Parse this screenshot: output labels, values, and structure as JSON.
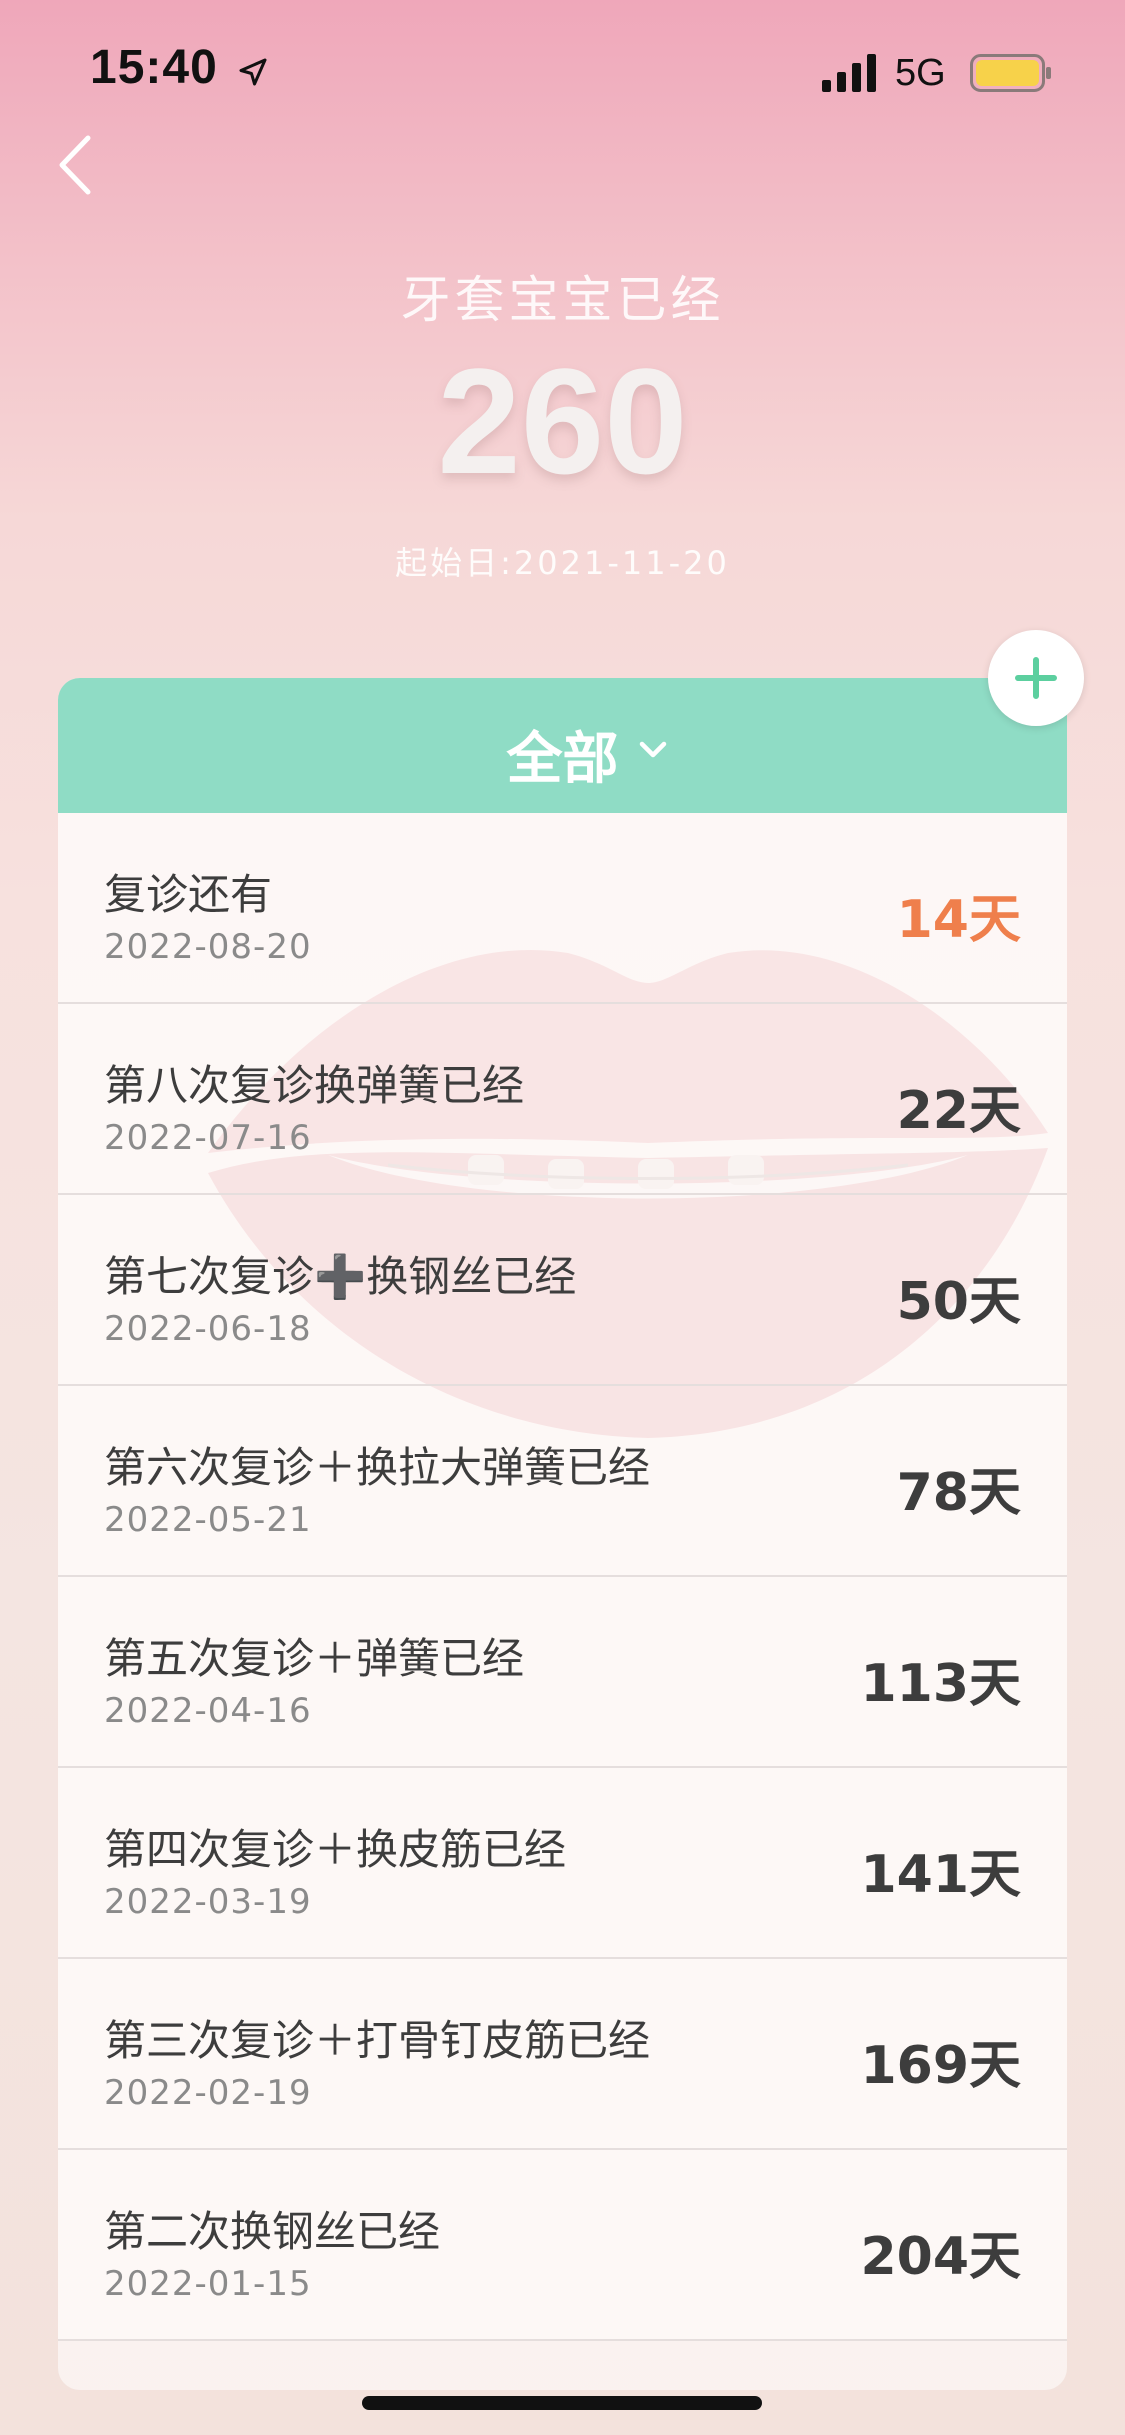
{
  "status_bar": {
    "time": "15:40",
    "network": "5G",
    "icons": [
      "location-arrow-icon",
      "signal-bars-icon",
      "battery-icon"
    ],
    "battery_color": "#f7d24a"
  },
  "nav": {
    "back_icon": "chevron-left-icon"
  },
  "header": {
    "subtitle": "牙套宝宝已经",
    "count": "260",
    "start_date": "起始日:2021-11-20"
  },
  "filter": {
    "label": "全部",
    "icon": "chevron-down-icon",
    "color": "#8fdcc5"
  },
  "add_button": {
    "icon": "plus-icon",
    "color": "#5ccf9f"
  },
  "accent_color": "#ef7f4c",
  "items": [
    {
      "title": "复诊还有",
      "date": "2022-08-20",
      "days": "14天"
    },
    {
      "title": "第八次复诊换弹簧已经",
      "date": "2022-07-16",
      "days": "22天"
    },
    {
      "title": "第七次复诊➕换钢丝已经",
      "date": "2022-06-18",
      "days": "50天"
    },
    {
      "title": "第六次复诊＋换拉大弹簧已经",
      "date": "2022-05-21",
      "days": "78天"
    },
    {
      "title": "第五次复诊＋弹簧已经",
      "date": "2022-04-16",
      "days": "113天"
    },
    {
      "title": "第四次复诊＋换皮筋已经",
      "date": "2022-03-19",
      "days": "141天"
    },
    {
      "title": "第三次复诊＋打骨钉皮筋已经",
      "date": "2022-02-19",
      "days": "169天"
    },
    {
      "title": "第二次换钢丝已经",
      "date": "2022-01-15",
      "days": "204天"
    }
  ]
}
